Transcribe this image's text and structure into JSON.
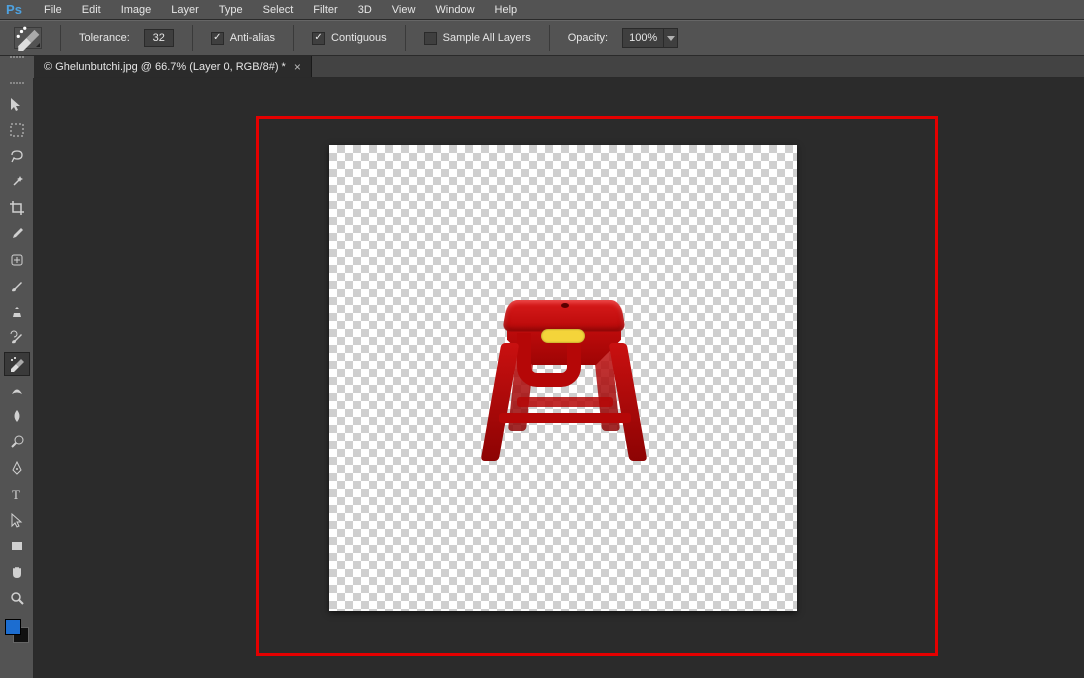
{
  "app_logo_text": "Ps",
  "menu": {
    "file": "File",
    "edit": "Edit",
    "image": "Image",
    "layer": "Layer",
    "type": "Type",
    "select": "Select",
    "filter": "Filter",
    "threeD": "3D",
    "view": "View",
    "window": "Window",
    "help": "Help"
  },
  "options": {
    "tolerance_label": "Tolerance:",
    "tolerance_value": "32",
    "antialias_label": "Anti-alias",
    "antialias_checked": true,
    "contiguous_label": "Contiguous",
    "contiguous_checked": true,
    "sample_all_label": "Sample All Layers",
    "sample_all_checked": false,
    "opacity_label": "Opacity:",
    "opacity_value": "100%"
  },
  "tab": {
    "title": "© Ghelunbutchi.jpg @ 66.7% (Layer 0, RGB/8#) *"
  },
  "tools": [
    "move",
    "marquee",
    "lasso",
    "magic-wand",
    "crop",
    "eyedropper",
    "healing-brush",
    "brush",
    "clone-stamp",
    "history-brush",
    "background-eraser",
    "gradient",
    "blur",
    "sponge",
    "pen",
    "type",
    "path-selection",
    "rectangle",
    "hand",
    "zoom"
  ],
  "active_tool_index": 10,
  "swatches": {
    "fg": "#1c6dd0",
    "bg": "#111111"
  },
  "canvas": {
    "subject": "red-plastic-stool",
    "background": "transparent-checker"
  }
}
